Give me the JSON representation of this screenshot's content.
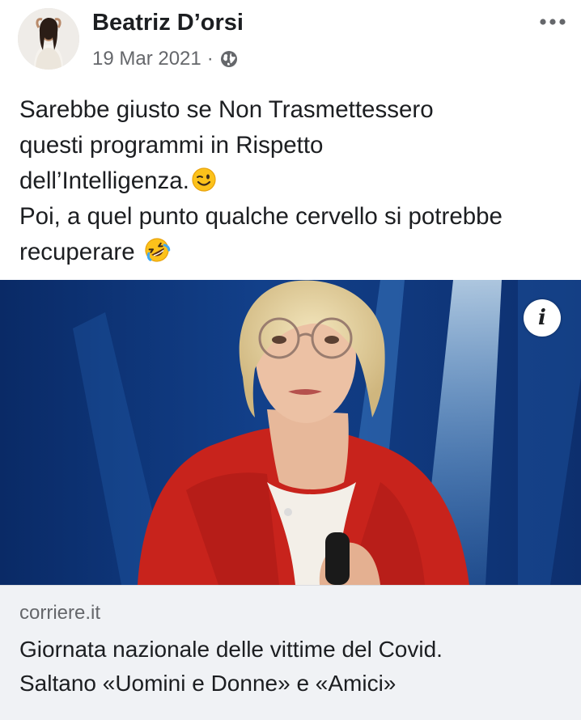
{
  "post": {
    "author": "Beatriz D’orsi",
    "date": "19 Mar 2021",
    "separator": "·",
    "audience_icon": "globe-icon",
    "more_icon": "more-options-icon",
    "text_lines": [
      "Sarebbe giusto se Non Trasmettessero",
      "questi programmi in Rispetto",
      "dell’Intelligenza.",
      "Poi, a quel punto qualche cervello si potrebbe",
      "recuperare"
    ],
    "emojis": [
      "winking-face-emoji",
      "rolling-on-floor-laughing-emoji"
    ]
  },
  "link": {
    "info_label": "i",
    "domain": "corriere.it",
    "title_lines": [
      "Giornata nazionale delle vittime del Covid.",
      "Saltano «Uomini e Donne» e «Amici»"
    ]
  },
  "colors": {
    "text_primary": "#1c1e21",
    "text_secondary": "#65676b",
    "footer_background": "#f0f2f5",
    "photo_background": "#0c2c63",
    "jacket_red": "#c8231c"
  }
}
